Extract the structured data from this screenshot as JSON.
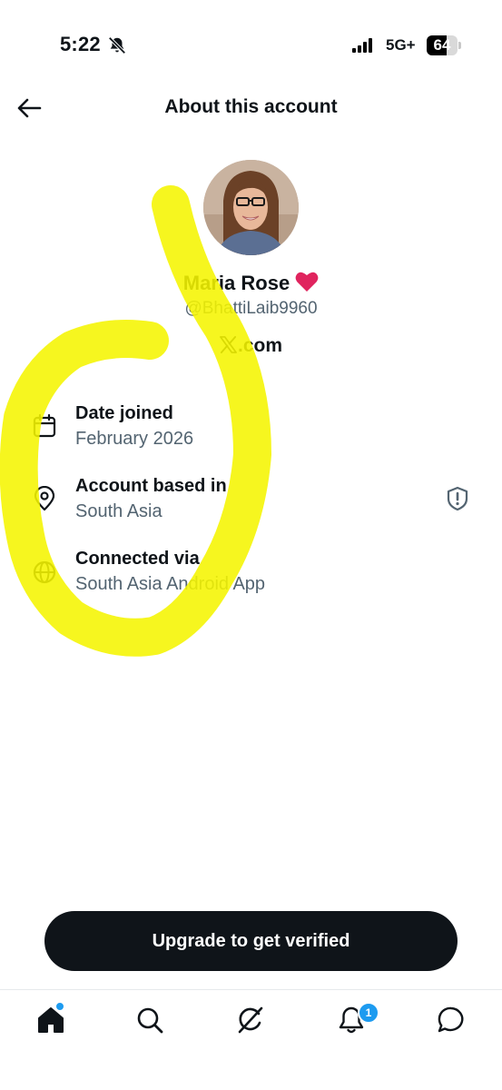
{
  "status_bar": {
    "time": "5:22",
    "network": "5G+",
    "battery": "64",
    "battery_level": 0.64
  },
  "header": {
    "title": "About this account"
  },
  "profile": {
    "display_name": "Maria Rose",
    "handle": "@BhattiLaib9960",
    "platform": ".com"
  },
  "info": {
    "date_joined_label": "Date joined",
    "date_joined_value": "February 2026",
    "based_in_label": "Account based in",
    "based_in_value": "South Asia",
    "connected_label": "Connected via",
    "connected_value": "South Asia Android App"
  },
  "cta": {
    "label": "Upgrade to get verified"
  },
  "tabbar": {
    "notifications_badge": "1"
  },
  "colors": {
    "accent": "#1d9bf0",
    "text_primary": "#0f1419",
    "text_secondary": "#536471",
    "highlighter": "#f5f500"
  }
}
